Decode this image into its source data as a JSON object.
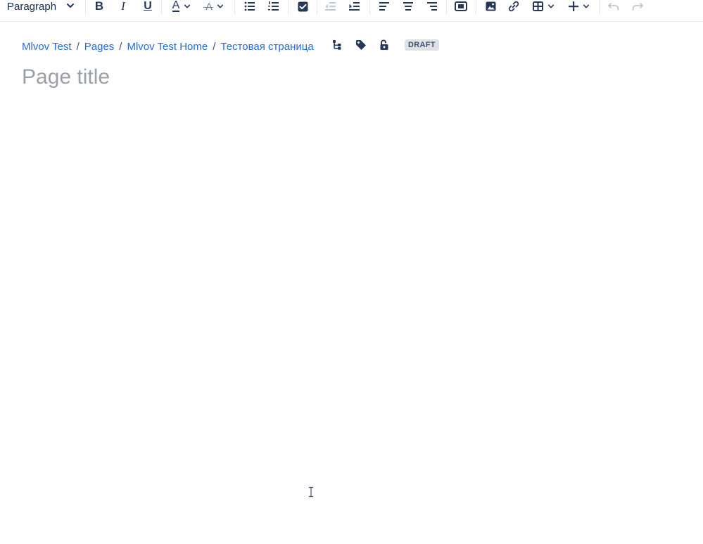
{
  "toolbar": {
    "paragraph_label": "Paragraph",
    "bold": "B",
    "italic": "I",
    "underline": "U",
    "text_color": "A",
    "clear_formatting": "A"
  },
  "breadcrumb": {
    "items": [
      "Mlvov Test",
      "Pages",
      "Mlvov Test Home",
      "Тестовая страница"
    ],
    "separator": "/"
  },
  "page_meta": {
    "status_badge": "DRAFT"
  },
  "title": {
    "placeholder": "Page title",
    "value": ""
  },
  "colors": {
    "link": "#0052cc",
    "icon": "#42526e",
    "badge_bg": "#dfe1e6",
    "placeholder": "#9aa0a8"
  }
}
